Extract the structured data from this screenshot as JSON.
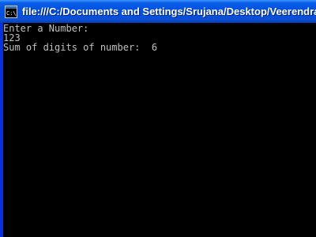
{
  "window": {
    "title": "file:///C:/Documents and Settings/Srujana/Desktop/Veerendra",
    "icon": "console-icon"
  },
  "console": {
    "lines": [
      "Enter a Number:",
      "123",
      "Sum of digits of number:  6"
    ],
    "colors": {
      "background": "#000000",
      "text": "#c0c0c0"
    }
  },
  "colors": {
    "titlebar": "#0054e3",
    "frame": "#0831d9"
  }
}
